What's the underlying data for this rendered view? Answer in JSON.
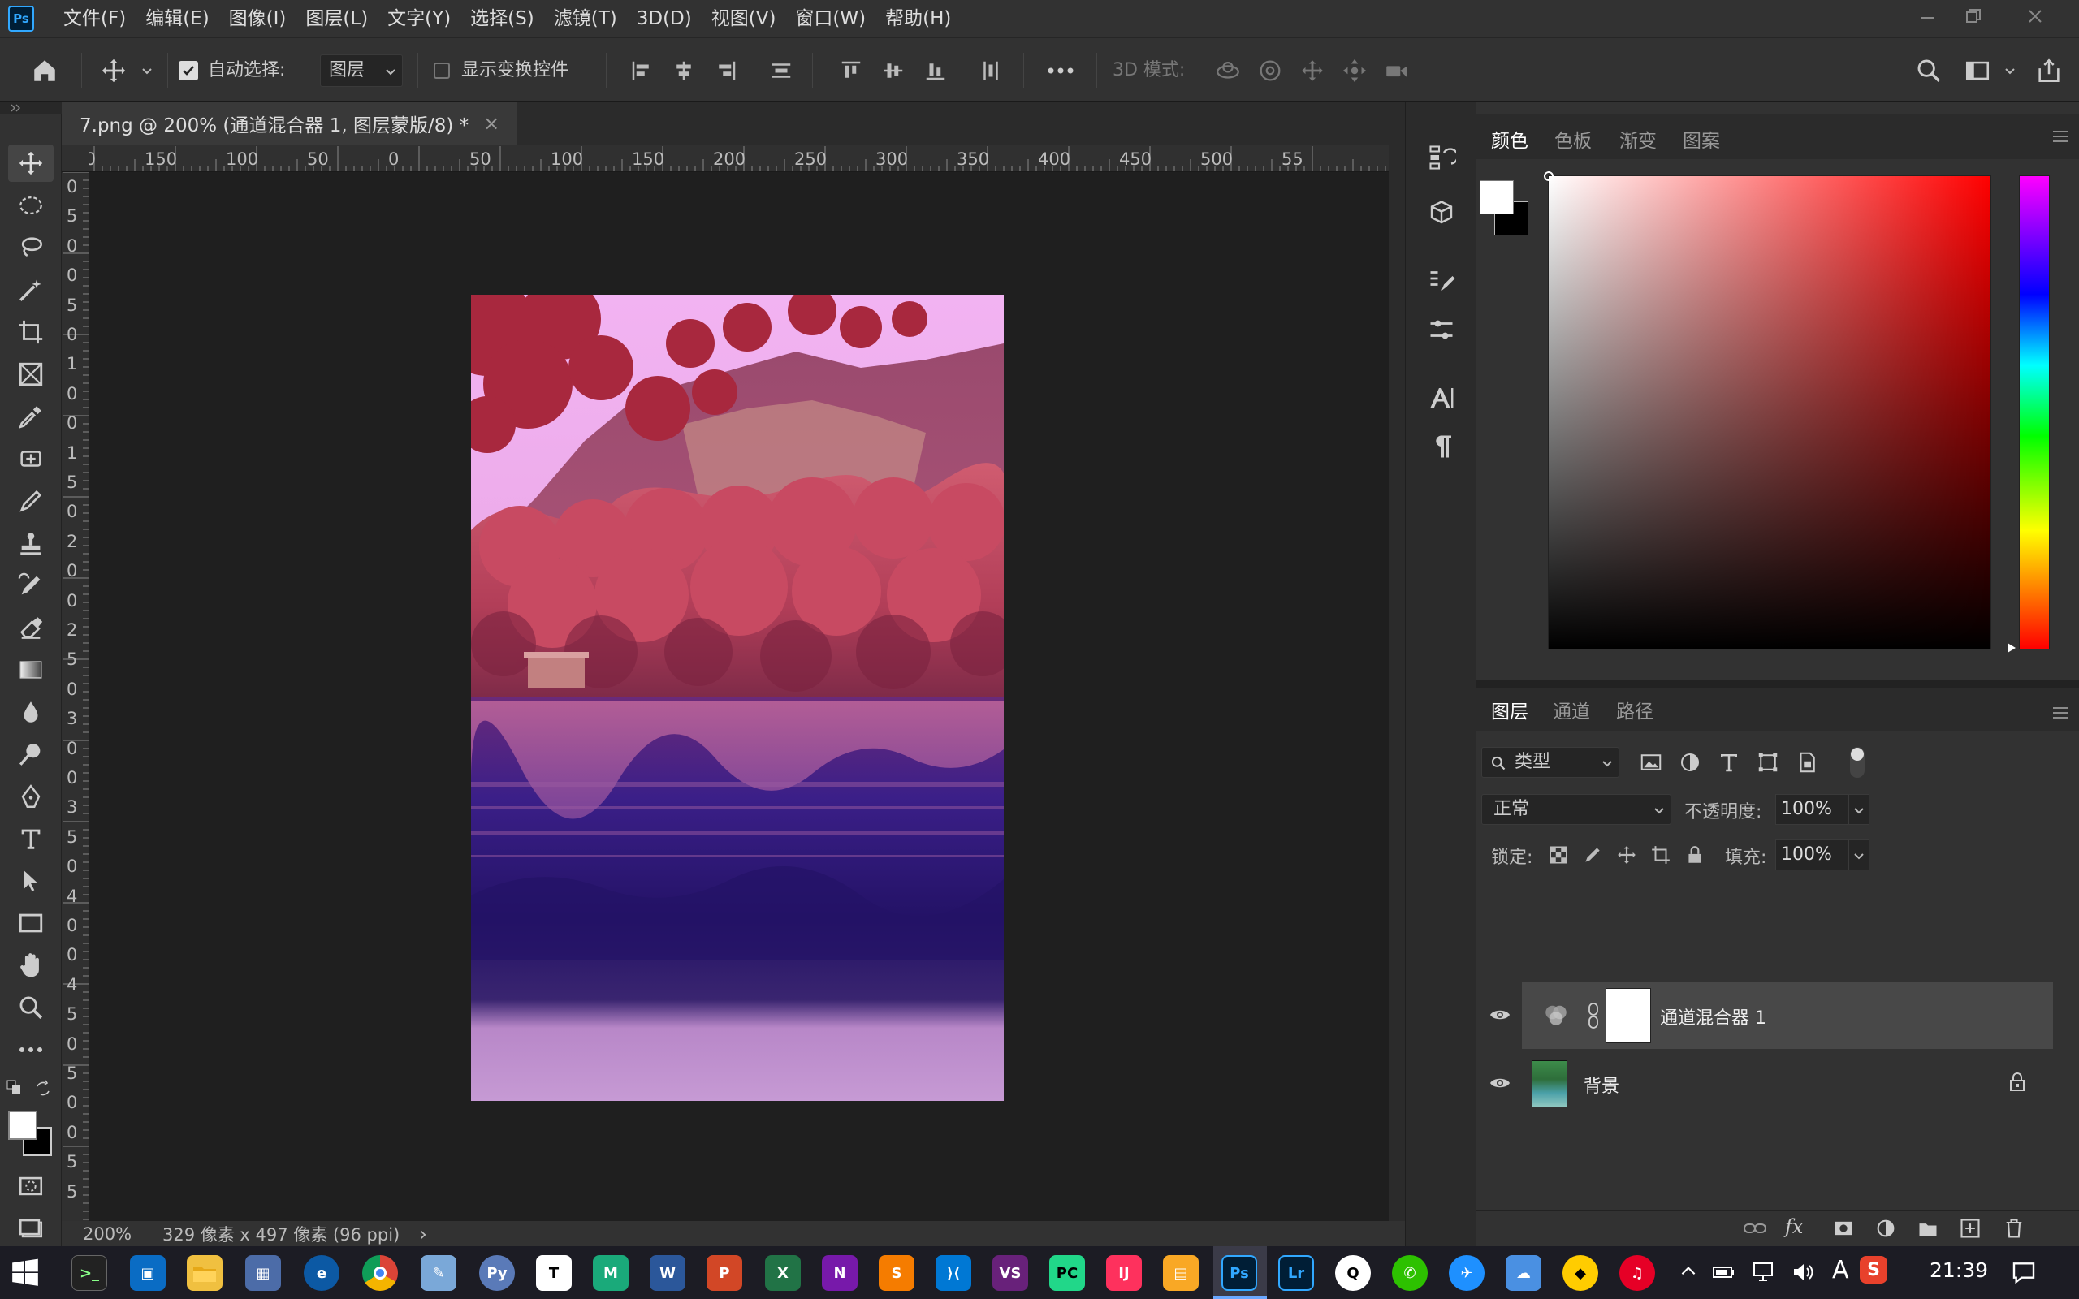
{
  "app": {
    "logo": "Ps"
  },
  "menu": [
    "文件(F)",
    "编辑(E)",
    "图像(I)",
    "图层(L)",
    "文字(Y)",
    "选择(S)",
    "滤镜(T)",
    "3D(D)",
    "视图(V)",
    "窗口(W)",
    "帮助(H)"
  ],
  "options": {
    "auto_select_label": "自动选择:",
    "auto_select_value": "图层",
    "show_transform_label": "显示变换控件",
    "mode_3d_label": "3D 模式:",
    "auto_select_checked": true,
    "show_transform_checked": false
  },
  "document": {
    "tab_title": "7.png @ 200% (通道混合器 1, 图层蒙版/8) *",
    "close_glyph": "×",
    "zoom": "200%",
    "dimensions": "329 像素 x 497 像素 (96 ppi)",
    "status_arrow": "›"
  },
  "ruler_h": [
    "200",
    "150",
    "100",
    "50",
    "0",
    "50",
    "100",
    "150",
    "200",
    "250",
    "300",
    "350",
    "400",
    "450",
    "500",
    "55"
  ],
  "ruler_v": [
    "0",
    "5",
    "0",
    "0",
    "5",
    "0",
    "1",
    "0",
    "0",
    "1",
    "5",
    "0",
    "2",
    "0",
    "0",
    "2",
    "5",
    "0",
    "3",
    "0",
    "0",
    "3",
    "5",
    "0",
    "4",
    "0",
    "0",
    "4",
    "5",
    "0",
    "5",
    "0",
    "0",
    "5",
    "5"
  ],
  "color_panel": {
    "tabs": [
      "颜色",
      "色板",
      "渐变",
      "图案"
    ],
    "active_tab": "颜色",
    "foreground": "#ffffff",
    "background": "#000000",
    "hue": "#ff0000"
  },
  "layers_panel": {
    "tabs": [
      "图层",
      "通道",
      "路径"
    ],
    "active_tab": "图层",
    "filter_kind": "类型",
    "blend_mode": "正常",
    "opacity_label": "不透明度:",
    "opacity": "100%",
    "lock_label": "锁定:",
    "fill_label": "填充:",
    "fill": "100%",
    "layers": [
      {
        "name": "通道混合器 1",
        "type": "adjustment",
        "selected": true,
        "visible": true
      },
      {
        "name": "背景",
        "type": "image",
        "selected": false,
        "visible": true,
        "locked": true
      }
    ]
  },
  "taskbar": {
    "time": "21:39",
    "ime": "A",
    "apps": [
      "windows-start",
      "terminal",
      "remote-desktop",
      "file-explorer",
      "calculator",
      "edge",
      "chrome",
      "notepad",
      "python",
      "typora",
      "mindmaster",
      "word",
      "powerpoint",
      "excel",
      "onenote",
      "sublime",
      "vscode",
      "visual-studio",
      "pycharm",
      "intellij",
      "notebook",
      "photoshop",
      "lightroom",
      "qq",
      "wechat",
      "feishu",
      "baidu",
      "clash",
      "netease-music"
    ]
  },
  "colors": {
    "accent": "#31a8ff",
    "panel_bg": "#323232",
    "canvas_bg": "#1f1f1f"
  }
}
